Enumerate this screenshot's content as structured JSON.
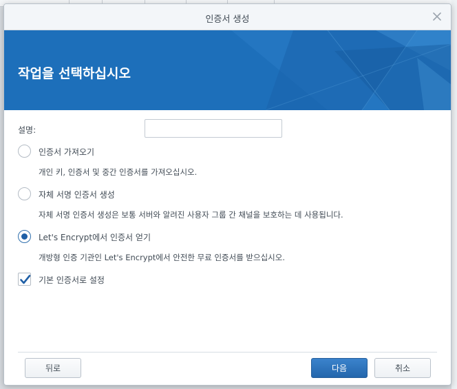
{
  "dialog": {
    "title": "인증서 생성",
    "heading": "작업을 선택하십시오"
  },
  "form": {
    "description_label": "설명:",
    "description_value": "",
    "options": [
      {
        "label": "인증서 가져오기",
        "help": "개인 키, 인증서 및 중간 인증서를 가져오십시오.",
        "checked": false
      },
      {
        "label": "자체 서명 인증서 생성",
        "help": "자체 서명 인증서 생성은 보통 서버와 알려진 사용자 그룹 간 채널을 보호하는 데 사용됩니다.",
        "checked": false
      },
      {
        "label": "Let's Encrypt에서 인증서 얻기",
        "help": "개방형 인증 기관인 Let's Encrypt에서 안전한 무료 인증서를 받으십시오.",
        "checked": true
      }
    ],
    "default_checkbox": {
      "label": "기본 인증서로 설정",
      "checked": true
    }
  },
  "buttons": {
    "back": "뒤로",
    "next": "다음",
    "cancel": "취소"
  },
  "icons": {
    "close": "close-icon",
    "check": "checkmark-icon"
  },
  "colors": {
    "accent": "#1f5fa6",
    "banner": "#1d6fba"
  }
}
